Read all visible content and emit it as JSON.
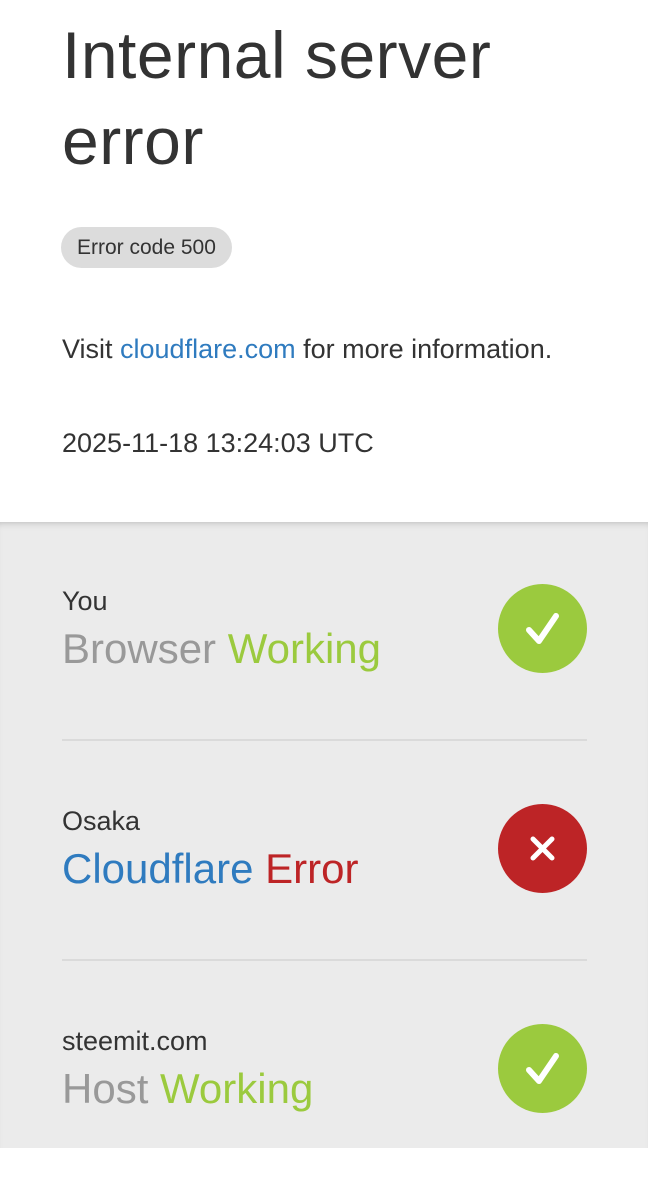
{
  "page": {
    "title": "Internal server error",
    "error_code": "Error code 500",
    "visit_prefix": "Visit ",
    "visit_link": "cloudflare.com",
    "visit_suffix": " for more information.",
    "timestamp": "2025-11-18 13:24:03 UTC"
  },
  "statuses": [
    {
      "location": "You",
      "name": "Browser",
      "status": "Working",
      "icon": "check-icon",
      "color": "#9bca3e"
    },
    {
      "location": "Osaka",
      "name": "Cloudflare",
      "status": "Error",
      "icon": "close-icon",
      "color": "#bd2426"
    },
    {
      "location": "steemit.com",
      "name": "Host",
      "status": "Working",
      "icon": "check-icon",
      "color": "#9bca3e"
    }
  ],
  "colors": {
    "link": "#2f7bbf",
    "ok": "#9bca3e",
    "error": "#bd2426",
    "text": "#333333",
    "muted": "#999999"
  }
}
